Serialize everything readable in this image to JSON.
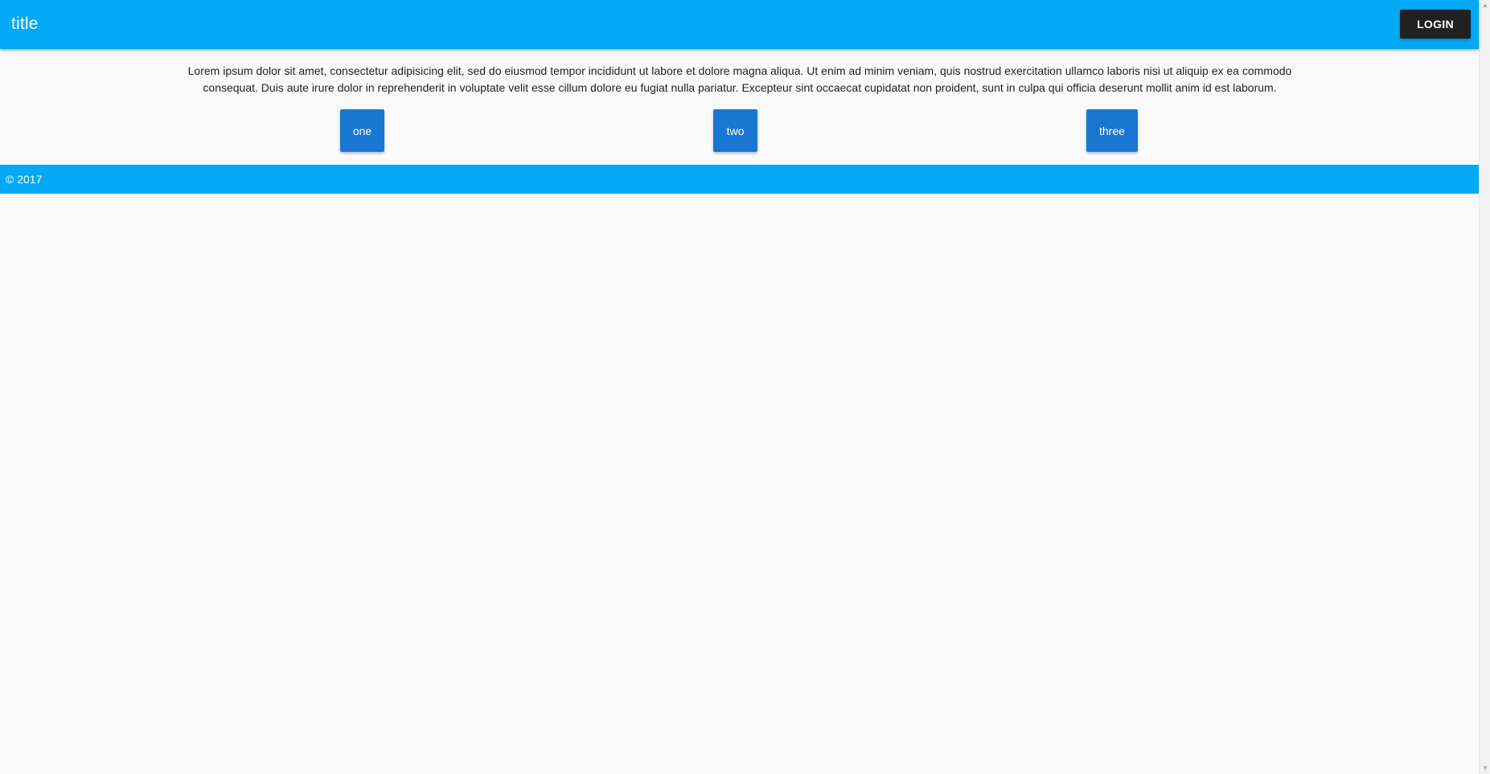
{
  "app_bar": {
    "title": "title",
    "login_label": "LOGIN",
    "color": "#03a9f4"
  },
  "main": {
    "body_text": "Lorem ipsum dolor sit amet, consectetur adipisicing elit, sed do eiusmod tempor incididunt ut labore et dolore magna aliqua. Ut enim ad minim veniam, quis nostrud exercitation ullamco laboris nisi ut aliquip ex ea commodo consequat. Duis aute irure dolor in reprehenderit in voluptate velit esse cillum dolore eu fugiat nulla pariatur. Excepteur sint occaecat cupidatat non proident, sunt in culpa qui officia deserunt mollit anim id est laborum.",
    "buttons": [
      {
        "label": "one"
      },
      {
        "label": "two"
      },
      {
        "label": "three"
      }
    ],
    "button_color": "#1976d2"
  },
  "footer": {
    "text": "© 2017",
    "color": "#03a9f4"
  },
  "scrollbar": {
    "up_icon": "scroll-up-arrow-icon",
    "down_icon": "scroll-down-arrow-icon"
  }
}
